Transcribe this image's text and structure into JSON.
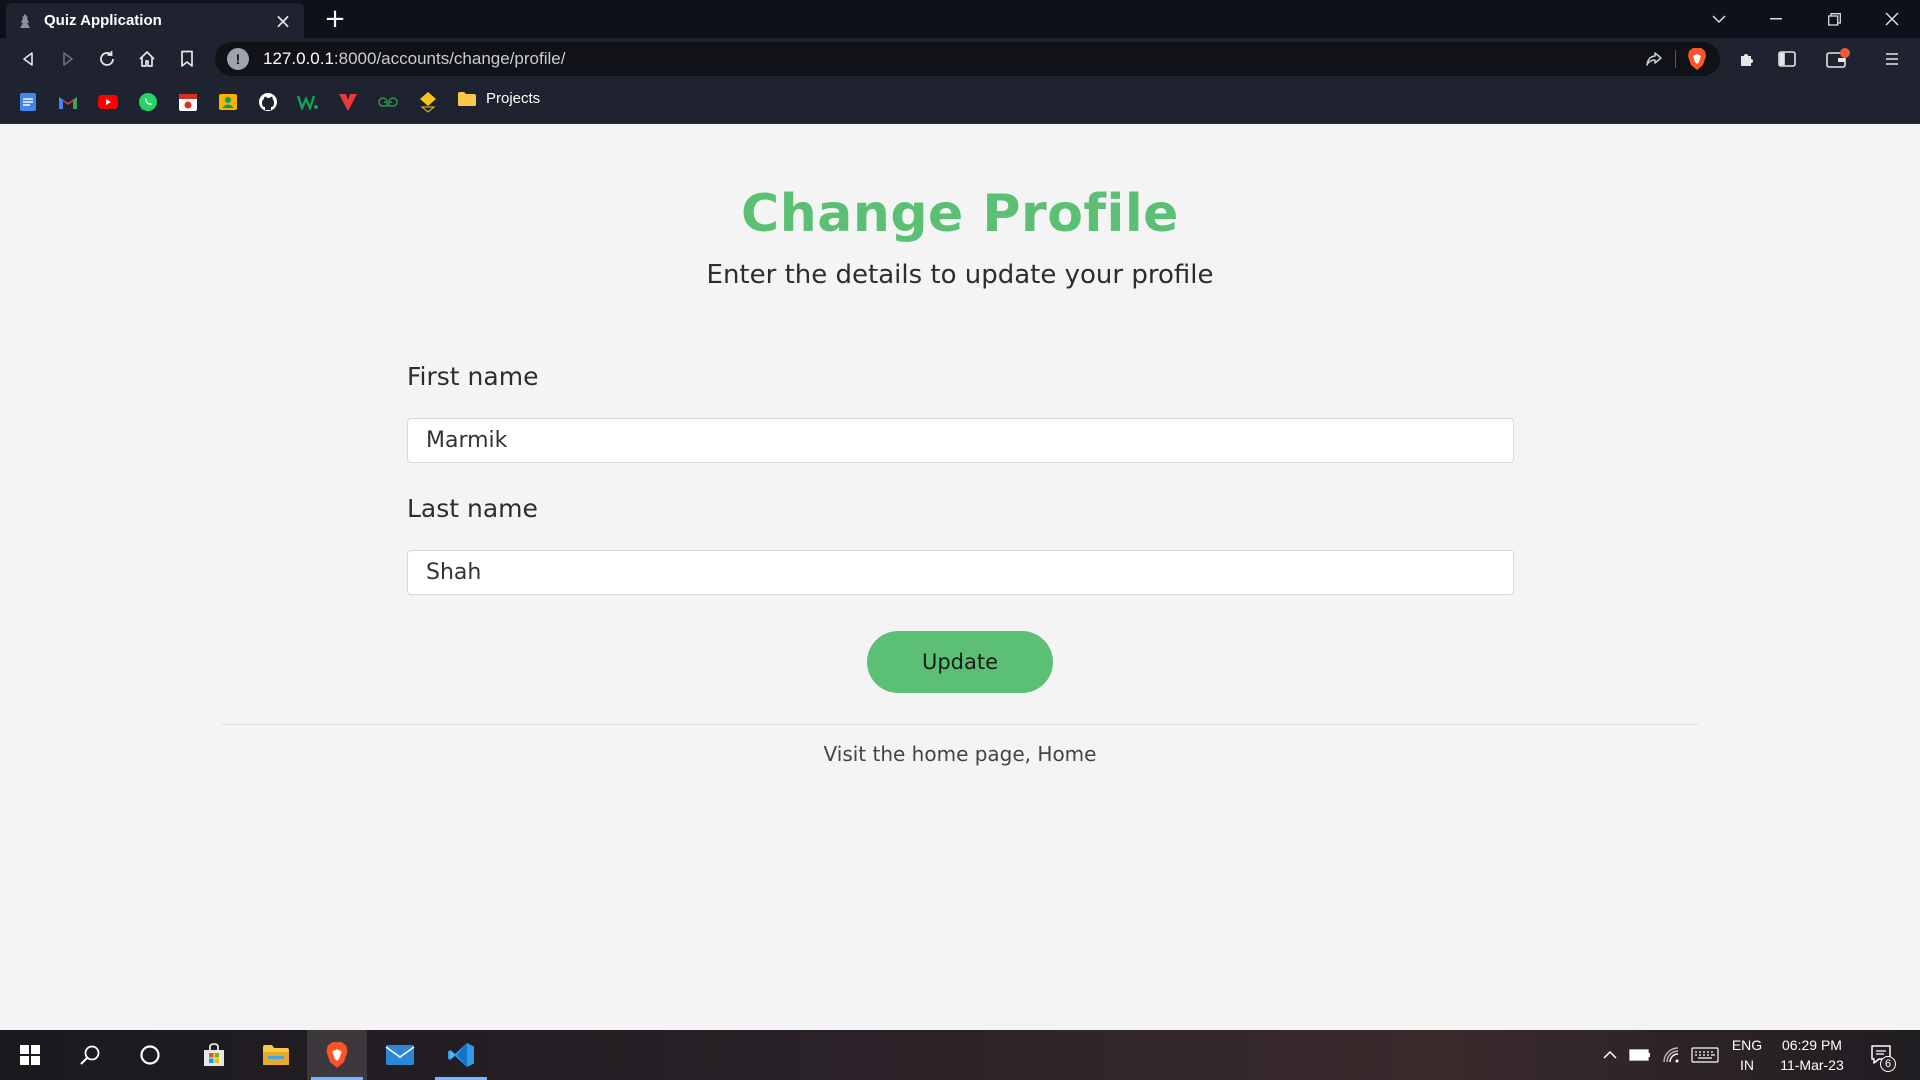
{
  "browser": {
    "tab_title": "Quiz Application",
    "url_host": "127.0.0.1",
    "url_rest": ":8000/accounts/change/profile/",
    "bookmarks": [
      {
        "icon": "google-docs-icon",
        "color": "#4285f4"
      },
      {
        "icon": "gmail-icon",
        "color": "#ea4335"
      },
      {
        "icon": "youtube-icon",
        "color": "#ff0000"
      },
      {
        "icon": "whatsapp-icon",
        "color": "#25d366"
      },
      {
        "icon": "calendar-icon",
        "color": "#d93025"
      },
      {
        "icon": "contacts-icon",
        "color": "#f4b400"
      },
      {
        "icon": "github-icon",
        "color": "#ffffff"
      },
      {
        "icon": "w-icon",
        "color": "#1a9e55"
      },
      {
        "icon": "vivaldi-icon",
        "color": "#ef3939"
      },
      {
        "icon": "geeksforgeeks-icon",
        "color": "#2f8d46"
      },
      {
        "icon": "sefaria-icon",
        "color": "#f5c518"
      }
    ],
    "bookmark_folder": "Projects"
  },
  "page": {
    "title": "Change Profile",
    "subtitle": "Enter the details to update your profile",
    "first_name_label": "First name",
    "first_name_value": "Marmik",
    "last_name_label": "Last name",
    "last_name_value": "Shah",
    "update_label": "Update",
    "footer_text": "Visit the home page,",
    "footer_link": "Home",
    "accent_color": "#5bbf74"
  },
  "taskbar": {
    "language": "ENG",
    "region": "IN",
    "time": "06:29 PM",
    "date": "11-Mar-23",
    "notification_count": "6"
  }
}
